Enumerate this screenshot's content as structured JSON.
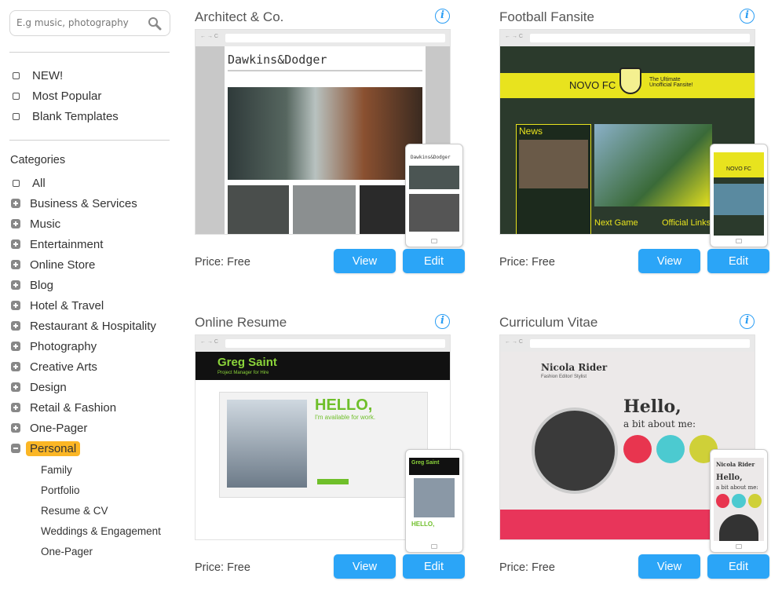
{
  "search": {
    "placeholder": "E.g music, photography",
    "icon": "search-icon"
  },
  "filters": [
    "NEW!",
    "Most Popular",
    "Blank Templates"
  ],
  "categories_heading": "Categories",
  "categories": [
    "All",
    "Business & Services",
    "Music",
    "Entertainment",
    "Online Store",
    "Blog",
    "Hotel & Travel",
    "Restaurant & Hospitality",
    "Photography",
    "Creative Arts",
    "Design",
    "Retail & Fashion",
    "One-Pager",
    "Personal"
  ],
  "selected_category": "Personal",
  "highlight_color": "#fbb625",
  "subcategories": [
    "Family",
    "Portfolio",
    "Resume & CV",
    "Weddings & Engagement",
    "One-Pager"
  ],
  "accent": "#2ba5f7",
  "cards": [
    {
      "title": "Architect & Co.",
      "price": "Price: Free",
      "view": "View",
      "edit": "Edit",
      "preview_headline": "Dawkins&Dodger",
      "phone_headline": "Dawkins&Dodger"
    },
    {
      "title": "Football Fansite",
      "price": "Price: Free",
      "view": "View",
      "edit": "Edit",
      "preview_headline": "NOVO FC",
      "preview_sub": "The Ultimate Unofficial Fansite!",
      "news": "News",
      "next_game": "Next Game",
      "links": "Official Links",
      "phone_headline": "NOVO FC"
    },
    {
      "title": "Online Resume",
      "price": "Price: Free",
      "view": "View",
      "edit": "Edit",
      "preview_headline": "Greg Saint",
      "preview_sub": "Project Manager for Hire",
      "hello": "HELLO,",
      "hello_sub": "I'm available for work.",
      "phone_headline": "Greg Saint",
      "phone_hello": "HELLO,"
    },
    {
      "title": "Curriculum Vitae",
      "price": "Price: Free",
      "view": "View",
      "edit": "Edit",
      "preview_headline": "Nicola Rider",
      "preview_sub": "Fashion Editor/ Stylist",
      "hello": "Hello,",
      "hello_sub": "a bit about me:",
      "phone_headline": "Nicola Rider",
      "phone_hello": "Hello,",
      "phone_hello_sub": "a bit about me:"
    }
  ]
}
